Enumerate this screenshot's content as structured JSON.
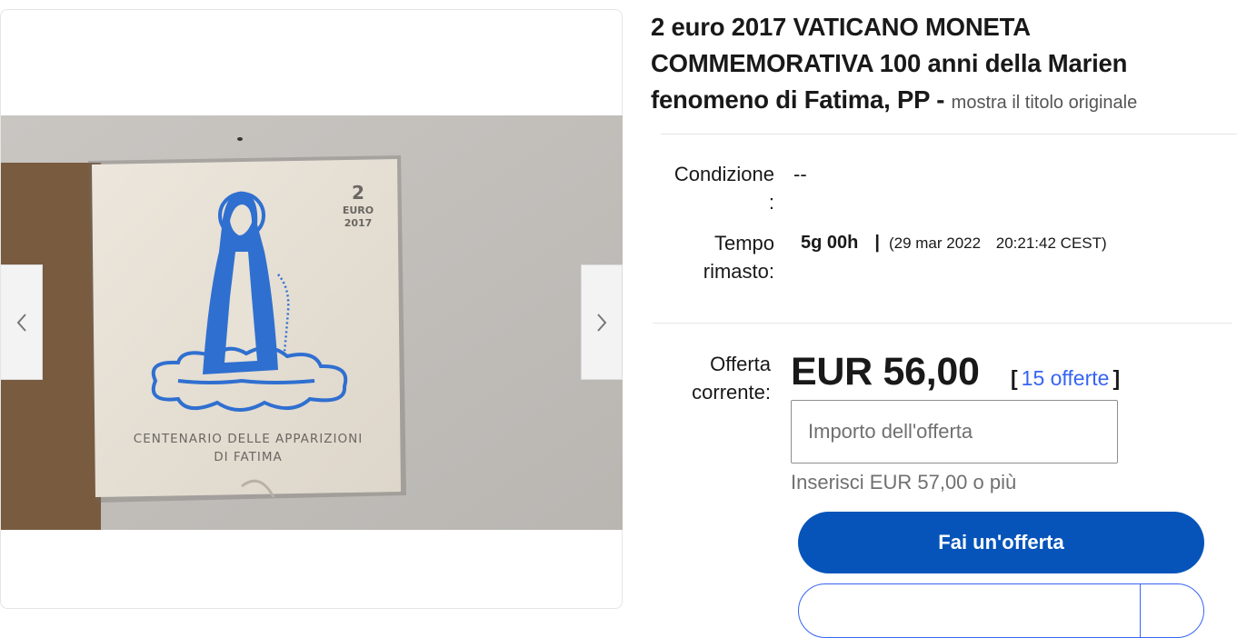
{
  "gallery": {
    "photo": {
      "denomination": "2",
      "currency": "EURO",
      "year": "2017",
      "caption_line1": "CENTENARIO DELLE APPARIZIONI",
      "caption_line2": "DI FATIMA"
    },
    "prev_icon": "chevron-left-icon",
    "next_icon": "chevron-right-icon"
  },
  "listing": {
    "title": "2 euro 2017 VATICANO MONETA COMMEMORATIVA 100 anni della Marien fenomeno di Fatima, PP",
    "title_separator": " - ",
    "show_original_title": "mostra il titolo originale"
  },
  "details": {
    "condition_label": "Condizione\n:",
    "condition_value": "--",
    "time_left_label": "Tempo\nrimasto:",
    "time_left_value": "5g 00h",
    "time_separator": "|",
    "end_date": "(29 mar 2022",
    "end_time": "20:21:42 CEST)"
  },
  "bidding": {
    "current_bid_label": "Offerta\ncorrente:",
    "current_price": "EUR 56,00",
    "bid_bracket_open": "[",
    "bid_count_link": "15 offerte",
    "bid_bracket_close": "]",
    "bid_input_placeholder": "Importo dell'offerta",
    "bid_hint": "Inserisci EUR 57,00 o più",
    "place_bid_button": "Fai un'offerta"
  },
  "colors": {
    "primary_button": "#0654ba",
    "link": "#3665f3",
    "text": "#191919",
    "muted": "#707070",
    "divider": "#e5e5e5"
  }
}
